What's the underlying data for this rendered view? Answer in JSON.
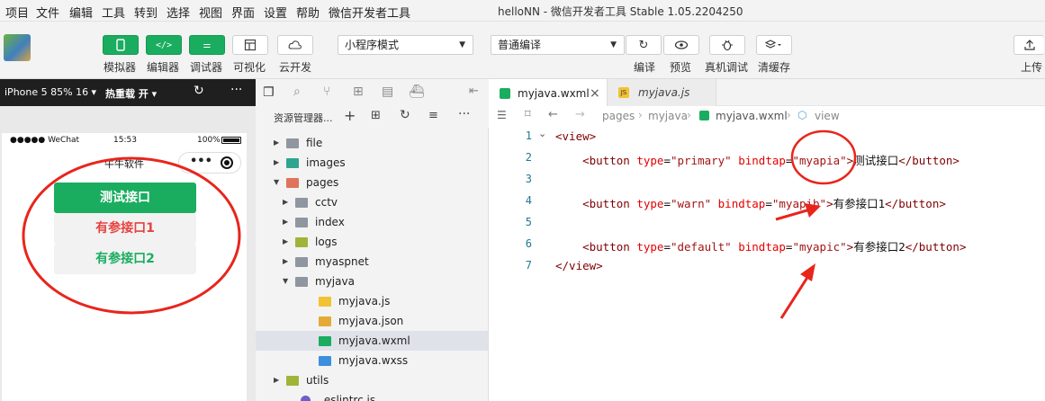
{
  "menu": [
    "项目",
    "文件",
    "编辑",
    "工具",
    "转到",
    "选择",
    "视图",
    "界面",
    "设置",
    "帮助",
    "微信开发者工具"
  ],
  "window_title": "helloNN - 微信开发者工具 Stable 1.05.2204250",
  "toolbar": {
    "simulator": "模拟器",
    "editor": "编辑器",
    "debugger": "调试器",
    "visual": "可视化",
    "cloud": "云开发",
    "mode_select": "小程序模式",
    "compile_select": "普通编译",
    "compile": "编译",
    "preview": "预览",
    "remote_debug": "真机调试",
    "clear_cache": "清缓存",
    "upload": "上传"
  },
  "simulator": {
    "device": "iPhone 5 85% 16 ▾",
    "hot_reload": "热重载 开 ▾",
    "status_carrier": "●●●●● WeChat",
    "status_time": "15:53",
    "status_battery": "100%",
    "nav_title": "牛牛软件",
    "buttons": [
      "测试接口",
      "有参接口1",
      "有参接口2"
    ]
  },
  "explorer": {
    "title": "资源管理器...",
    "tree": [
      {
        "label": "file",
        "type": "folder",
        "level": 0,
        "arrow": "▶"
      },
      {
        "label": "images",
        "type": "folder",
        "level": 0,
        "arrow": "▶"
      },
      {
        "label": "pages",
        "type": "folder",
        "level": 0,
        "arrow": "▼"
      },
      {
        "label": "cctv",
        "type": "folder",
        "level": 1,
        "arrow": "▶"
      },
      {
        "label": "index",
        "type": "folder",
        "level": 1,
        "arrow": "▶"
      },
      {
        "label": "logs",
        "type": "folder",
        "level": 1,
        "arrow": "▶"
      },
      {
        "label": "myaspnet",
        "type": "folder",
        "level": 1,
        "arrow": "▶"
      },
      {
        "label": "myjava",
        "type": "folder",
        "level": 1,
        "arrow": "▼"
      },
      {
        "label": "myjava.js",
        "type": "js",
        "level": 2,
        "arrow": ""
      },
      {
        "label": "myjava.json",
        "type": "json",
        "level": 2,
        "arrow": ""
      },
      {
        "label": "myjava.wxml",
        "type": "wxml",
        "level": 2,
        "arrow": ""
      },
      {
        "label": "myjava.wxss",
        "type": "wxss",
        "level": 2,
        "arrow": ""
      },
      {
        "label": "utils",
        "type": "folder",
        "level": 0,
        "arrow": "▶"
      },
      {
        "label": ".eslintrc.js",
        "type": "eslint",
        "level": 0,
        "arrow": ""
      }
    ]
  },
  "editor": {
    "tabs": [
      "myjava.wxml",
      "myjava.js"
    ],
    "breadcrumb": [
      "pages",
      "myjava",
      "myjava.wxml",
      "view"
    ],
    "lines": [
      {
        "num": "1",
        "tokens": [
          {
            "c": "t",
            "s": "<view>"
          }
        ]
      },
      {
        "num": "2",
        "tokens": [
          {
            "c": "t",
            "s": "    <button"
          },
          {
            "c": "a",
            "s": " type"
          },
          {
            "c": "tx",
            "s": "="
          },
          {
            "c": "va",
            "s": "\"primary\""
          },
          {
            "c": "a",
            "s": " bindtap"
          },
          {
            "c": "tx",
            "s": "="
          },
          {
            "c": "va",
            "s": "\"myapia\""
          },
          {
            "c": "t",
            "s": ">"
          },
          {
            "c": "tx",
            "s": "测试接口"
          },
          {
            "c": "t",
            "s": "</button>"
          }
        ]
      },
      {
        "num": "3",
        "tokens": []
      },
      {
        "num": "4",
        "tokens": [
          {
            "c": "t",
            "s": "    <button"
          },
          {
            "c": "a",
            "s": " type"
          },
          {
            "c": "tx",
            "s": "="
          },
          {
            "c": "va",
            "s": "\"warn\""
          },
          {
            "c": "a",
            "s": " bindtap"
          },
          {
            "c": "tx",
            "s": "="
          },
          {
            "c": "va",
            "s": "\"myapib\""
          },
          {
            "c": "t",
            "s": ">"
          },
          {
            "c": "tx",
            "s": "有参接口1"
          },
          {
            "c": "t",
            "s": "</button>"
          }
        ]
      },
      {
        "num": "5",
        "tokens": []
      },
      {
        "num": "6",
        "tokens": [
          {
            "c": "t",
            "s": "    <button"
          },
          {
            "c": "a",
            "s": " type"
          },
          {
            "c": "tx",
            "s": "="
          },
          {
            "c": "va",
            "s": "\"default\""
          },
          {
            "c": "a",
            "s": " bindtap"
          },
          {
            "c": "tx",
            "s": "="
          },
          {
            "c": "va",
            "s": "\"myapic\""
          },
          {
            "c": "t",
            "s": ">"
          },
          {
            "c": "tx",
            "s": "有参接口2"
          },
          {
            "c": "t",
            "s": "</button>"
          }
        ]
      },
      {
        "num": "7",
        "tokens": [
          {
            "c": "t",
            "s": "</view>"
          }
        ]
      }
    ]
  },
  "colors": {
    "green": "#1aad5f",
    "warn": "#e64340",
    "annotation": "#e8251c"
  }
}
